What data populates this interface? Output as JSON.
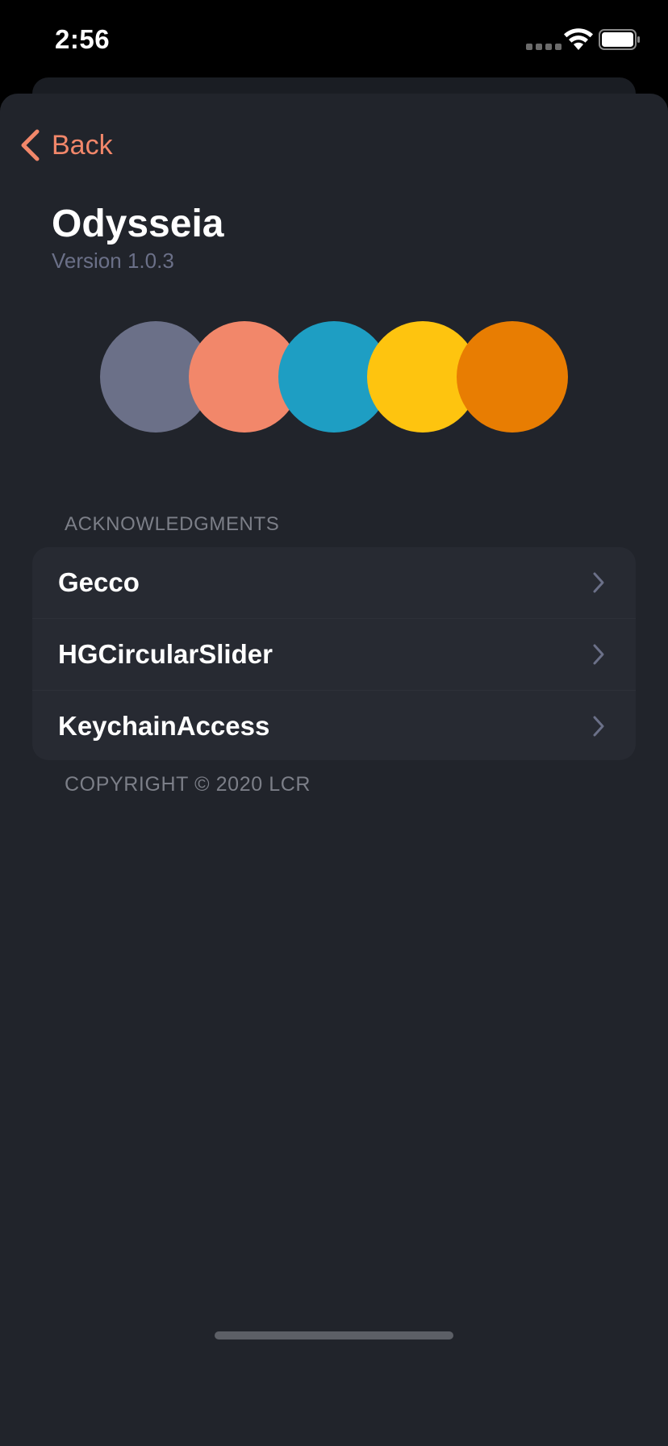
{
  "status_bar": {
    "time": "2:56",
    "icons": [
      "cellular-signal-icon",
      "wifi-icon",
      "battery-icon"
    ]
  },
  "nav": {
    "back_label": "Back",
    "accent_color": "#f2876a"
  },
  "app": {
    "title": "Odysseia",
    "version": "Version 1.0.3"
  },
  "swatches": [
    {
      "name": "slate",
      "color": "#6b7088"
    },
    {
      "name": "salmon",
      "color": "#f2876a"
    },
    {
      "name": "teal",
      "color": "#1e9ec3"
    },
    {
      "name": "yellow",
      "color": "#fec40f"
    },
    {
      "name": "orange",
      "color": "#e87d02"
    }
  ],
  "acknowledgments": {
    "header": "ACKNOWLEDGMENTS",
    "items": [
      {
        "label": "Gecco"
      },
      {
        "label": "HGCircularSlider"
      },
      {
        "label": "KeychainAccess"
      }
    ],
    "footer": "COPYRIGHT © 2020 LCR"
  }
}
